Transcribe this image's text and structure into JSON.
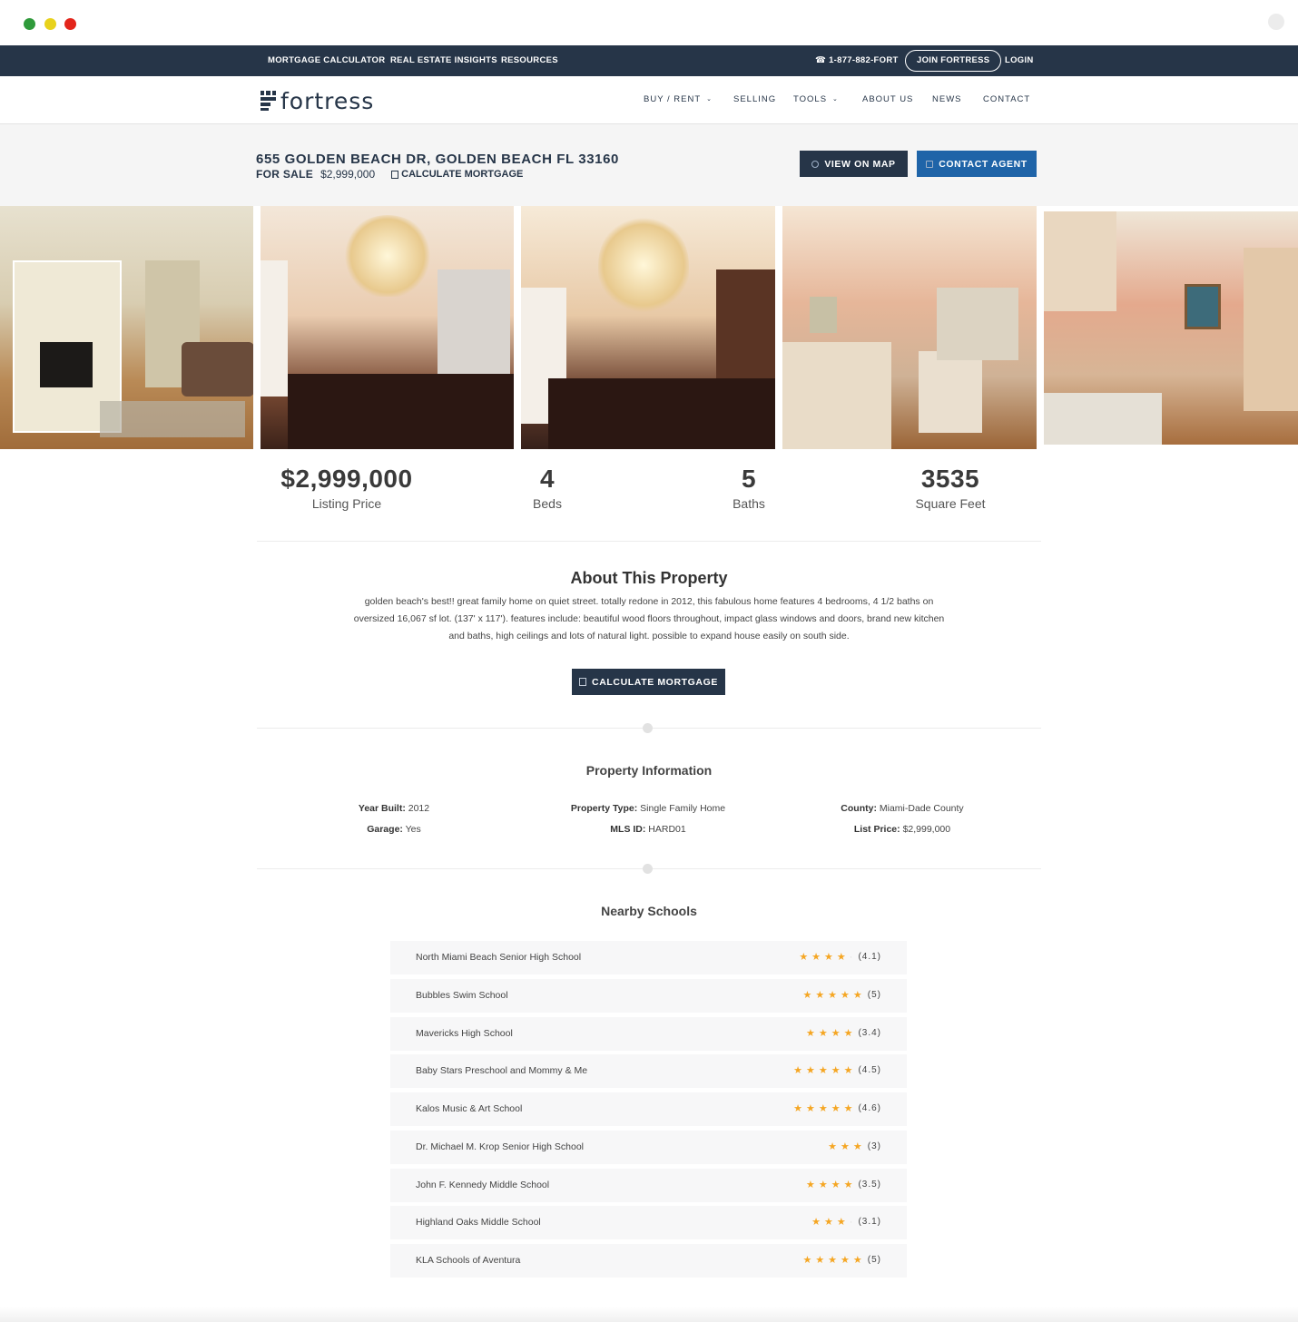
{
  "topbar": {
    "links": [
      "MORTGAGE CALCULATOR",
      "REAL ESTATE INSIGHTS",
      "RESOURCES"
    ],
    "phone": "1-877-882-FORT",
    "join": "JOIN FORTRESS",
    "login": "LOGIN"
  },
  "nav": {
    "logo": "fortress",
    "items": [
      "BUY / RENT",
      "SELLING",
      "TOOLS",
      "ABOUT US",
      "NEWS",
      "CONTACT"
    ]
  },
  "listing": {
    "address": "655 GOLDEN BEACH DR, GOLDEN BEACH FL 33160",
    "status": "FOR SALE",
    "price": "$2,999,000",
    "calc_link": "CALCULATE MORTGAGE",
    "btn_map": "VIEW ON MAP",
    "btn_agent": "CONTACT AGENT"
  },
  "stats": [
    {
      "value": "$2,999,000",
      "label": "Listing Price"
    },
    {
      "value": "4",
      "label": "Beds"
    },
    {
      "value": "5",
      "label": "Baths"
    },
    {
      "value": "3535",
      "label": "Square Feet"
    }
  ],
  "about": {
    "title": "About This Property",
    "text": "golden beach's best!! great family home on quiet street. totally redone in 2012, this fabulous home features 4 bedrooms, 4 1/2 baths on oversized 16,067 sf lot. (137' x 117'). features include: beautiful wood floors throughout, impact glass windows and doors, brand new kitchen and baths, high ceilings and lots of natural light. possible to expand house easily on south side.",
    "button": "CALCULATE MORTGAGE"
  },
  "property_info": {
    "title": "Property Information",
    "items": [
      {
        "label": "Year Built:",
        "value": "2012"
      },
      {
        "label": "Property Type:",
        "value": "Single Family Home"
      },
      {
        "label": "County:",
        "value": "Miami-Dade County"
      },
      {
        "label": "Garage:",
        "value": "Yes"
      },
      {
        "label": "MLS ID:",
        "value": "HARD01"
      },
      {
        "label": "List Price:",
        "value": "$2,999,000"
      }
    ]
  },
  "schools": {
    "title": "Nearby Schools",
    "items": [
      {
        "name": "North Miami Beach Senior High School",
        "rating": 4.1,
        "rating_text": "(4.1)"
      },
      {
        "name": "Bubbles Swim School",
        "rating": 5,
        "rating_text": "(5)"
      },
      {
        "name": "Mavericks High School",
        "rating": 3.4,
        "rating_text": "(3.4)"
      },
      {
        "name": "Baby Stars Preschool and Mommy & Me",
        "rating": 4.5,
        "rating_text": "(4.5)"
      },
      {
        "name": "Kalos Music & Art School",
        "rating": 4.6,
        "rating_text": "(4.6)"
      },
      {
        "name": "Dr. Michael M. Krop Senior High School",
        "rating": 3,
        "rating_text": "(3)"
      },
      {
        "name": "John F. Kennedy Middle School",
        "rating": 3.5,
        "rating_text": "(3.5)"
      },
      {
        "name": "Highland Oaks Middle School",
        "rating": 3.1,
        "rating_text": "(3.1)"
      },
      {
        "name": "KLA Schools of Aventura",
        "rating": 5,
        "rating_text": "(5)"
      }
    ]
  },
  "colors": {
    "navy": "#263548",
    "blue": "#1f64a8",
    "star": "#f5a623"
  }
}
